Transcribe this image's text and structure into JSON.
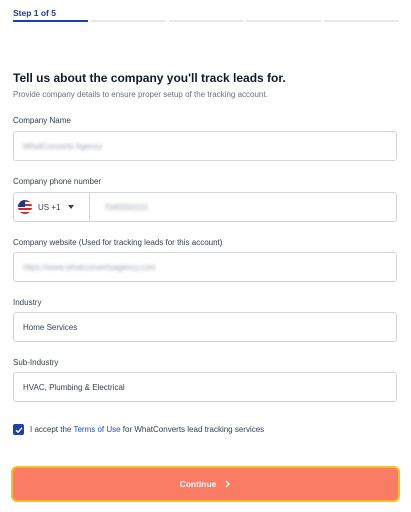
{
  "step": {
    "label": "Step 1 of 5",
    "current": 1,
    "total": 5
  },
  "heading": "Tell us about the company you'll track leads for.",
  "subheading": "Provide company details to ensure proper setup of the tracking account.",
  "company_name": {
    "label": "Company Name",
    "value": "WhatConverts Agency"
  },
  "phone": {
    "label": "Company phone number",
    "country_code": "US +1",
    "flag_icon": "us-flag-icon",
    "value": "7045550101"
  },
  "website": {
    "label": "Company website (Used for tracking leads for this account)",
    "value": "https://www.whatconvertsagency.com"
  },
  "industry": {
    "label": "Industry",
    "value": "Home Services"
  },
  "sub_industry": {
    "label": "Sub-Industry",
    "value": "HVAC, Plumbing & Electrical"
  },
  "terms": {
    "checked": true,
    "prefix": "I accept the",
    "link_text": "Terms of Use",
    "suffix": "for WhatConverts lead tracking services"
  },
  "continue": {
    "label": "Continue",
    "icon": "chevron-right-icon"
  },
  "colors": {
    "primary": "#1e40af",
    "button_bg": "#fb7c64",
    "button_border": "#fbbf24"
  }
}
